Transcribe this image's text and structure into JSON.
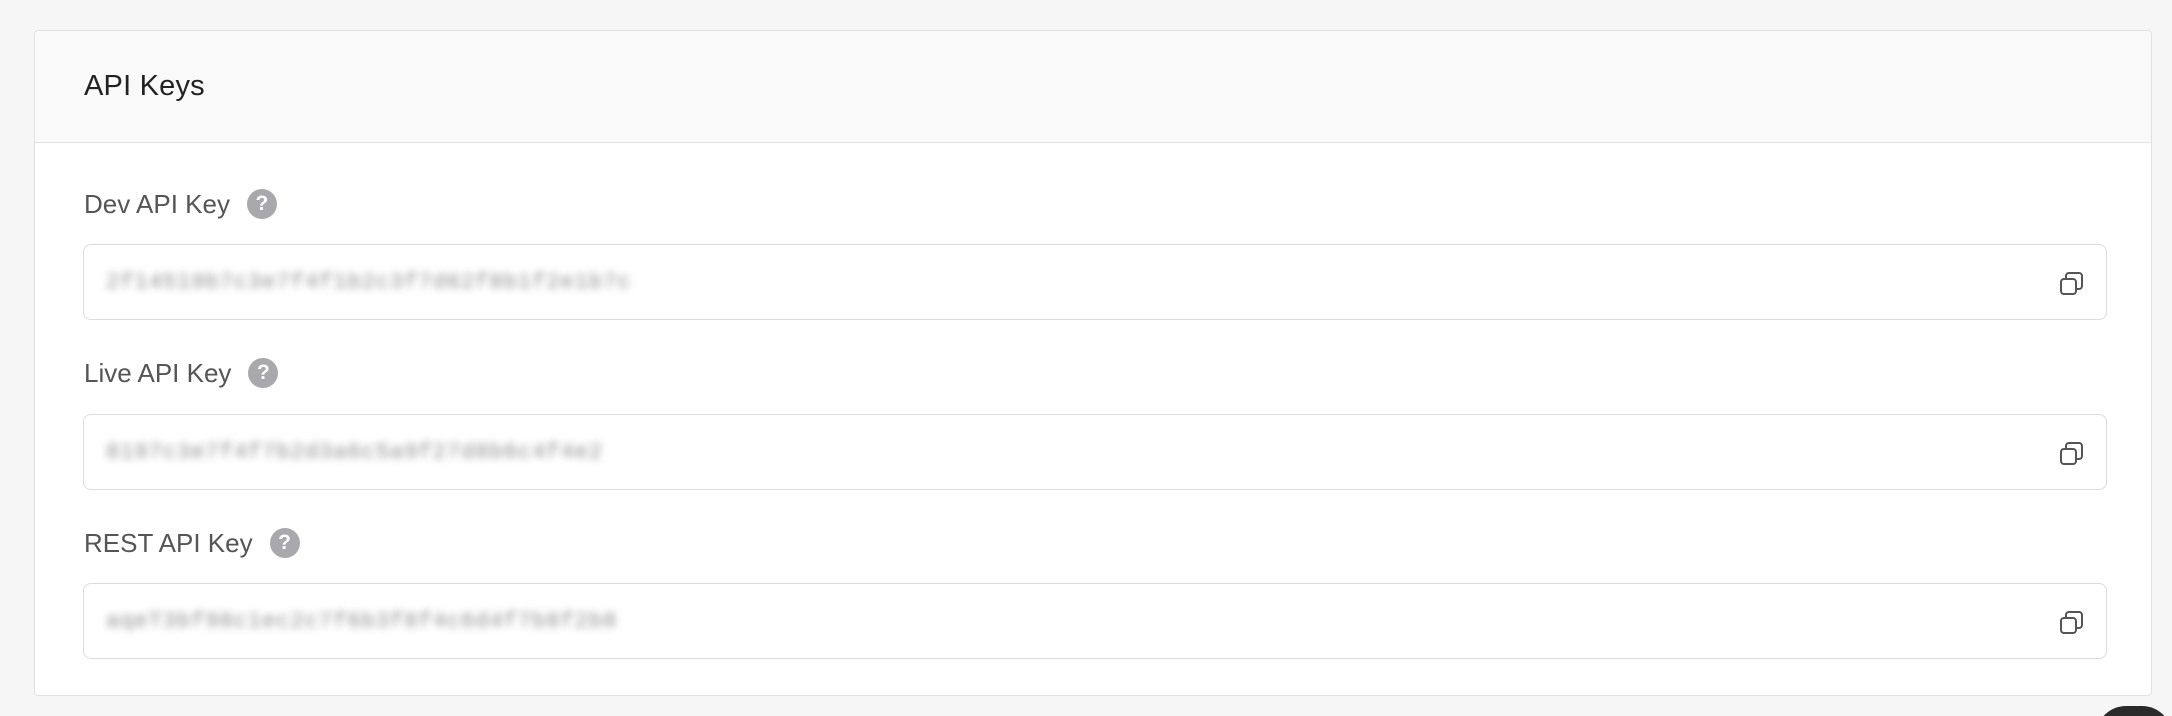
{
  "card": {
    "title": "API Keys"
  },
  "fields": [
    {
      "label": "Dev API Key",
      "value": "2f14519b7c3e7f4f1b2c3f7d62f8b1f2e1b7c"
    },
    {
      "label": "Live API Key",
      "value": "8197c3e7f4f7b2d3a6c5a9f27d8b6c4f4e2"
    },
    {
      "label": "REST API Key",
      "value": "aqeT3bf98c1ec2c7f6b3f8f4c6d4f7b8f2b8"
    }
  ],
  "icons": {
    "help": "question-mark-circle",
    "copy": "copy-clipboard"
  },
  "colors": {
    "card_header_bg": "#f9f9f9",
    "help_icon_bg": "#a9a9ad"
  }
}
